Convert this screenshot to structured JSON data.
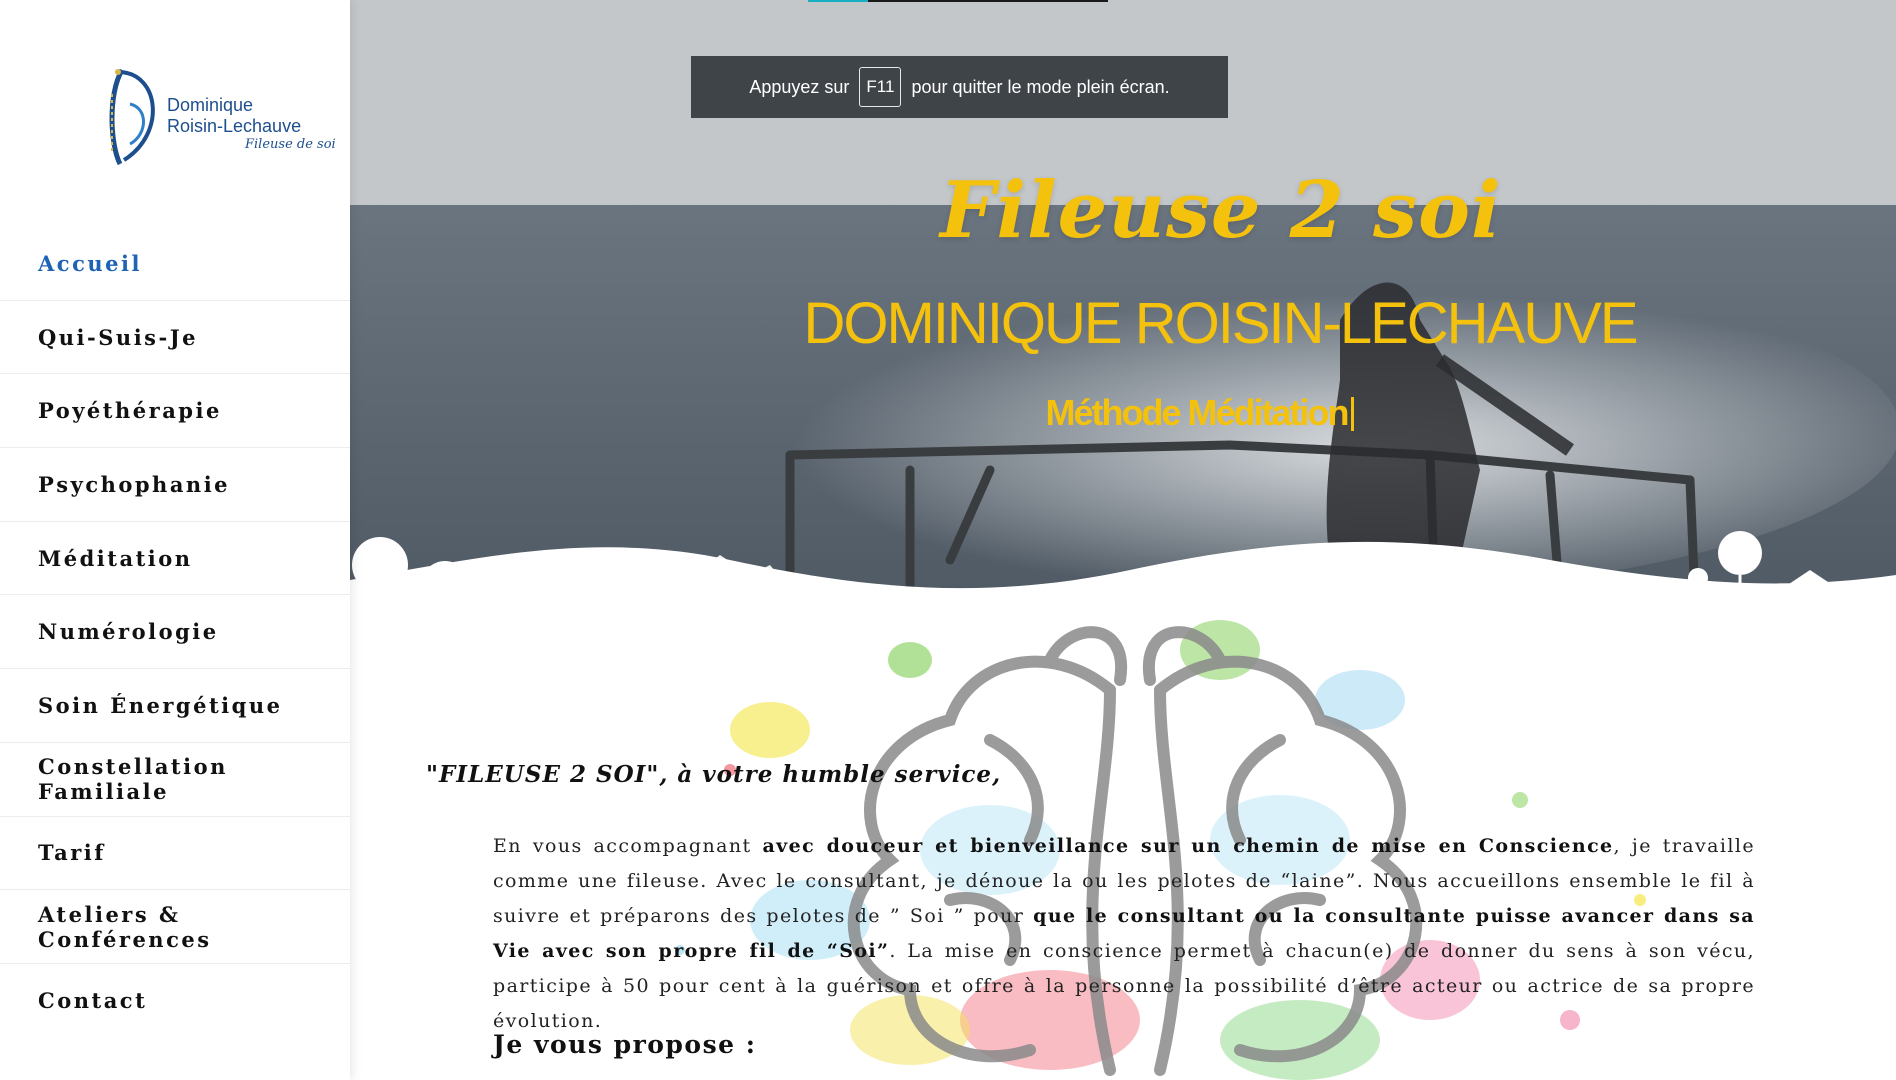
{
  "sidebar": {
    "logo": {
      "line1": "Dominique",
      "line2": "Roisin-Lechauve",
      "tagline": "Fileuse de soi"
    },
    "nav": [
      {
        "label": "Accueil",
        "active": true
      },
      {
        "label": "Qui-Suis-Je"
      },
      {
        "label": "Poyéthérapie"
      },
      {
        "label": "Psychophanie"
      },
      {
        "label": "Méditation"
      },
      {
        "label": "Numérologie"
      },
      {
        "label": "Soin Énergétique"
      },
      {
        "label": "Constellation Familiale"
      },
      {
        "label": "Tarif"
      },
      {
        "label": "Ateliers & Conférences"
      },
      {
        "label": "Contact"
      }
    ]
  },
  "fullscreen_notice": {
    "before": "Appuyez sur",
    "key": "F11",
    "after": "pour quitter le mode plein écran."
  },
  "hero": {
    "title": "Fileuse 2 soi",
    "name": "DOMINIQUE ROISIN-LECHAUVE",
    "subtitle": "Méthode Méditation"
  },
  "content": {
    "intro_heading": "\"FILEUSE 2 SOI\", à votre humble service,",
    "paragraph": {
      "p1": "En vous accompagnant ",
      "b1": "avec douceur et bienveillance sur un chemin de mise en Conscience",
      "p2": ", je travaille comme une fileuse. Avec le consultant, je dénoue la ou les pelotes de “laine”. Nous accueillons ensemble le fil à suivre et préparons  des pelotes de ” Soi ” pour ",
      "b2": "que le  consultant ou la consultante  puisse avancer dans sa Vie avec son propre fil de “Soi”",
      "p3": ". La mise en conscience permet à chacun(e) de donner du sens à son vécu, participe à 50 pour cent à la guérison et offre à la personne la possibilité d’être acteur ou actrice de sa propre évolution."
    },
    "propose_heading": "Je vous propose :"
  },
  "colors": {
    "accent_yellow": "#f4c20d",
    "nav_active": "#1f63b4",
    "logo_blue": "#1d4f8f"
  }
}
